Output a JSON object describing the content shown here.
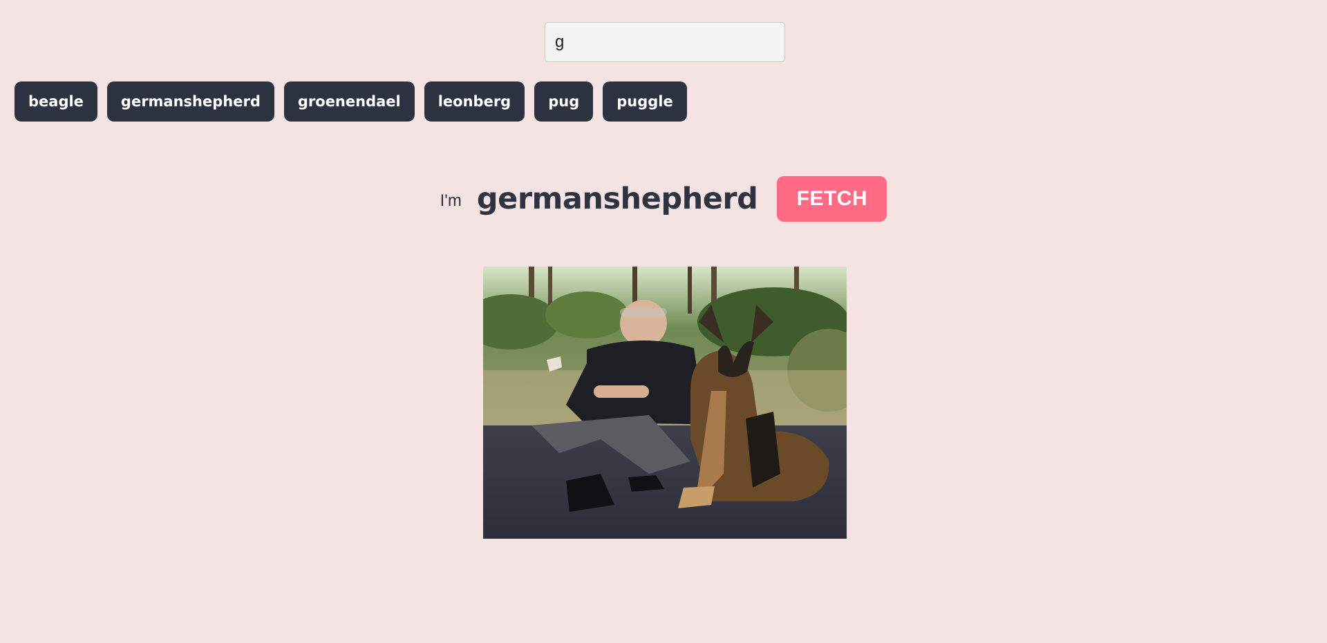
{
  "search": {
    "value": "g",
    "placeholder": ""
  },
  "breeds": [
    {
      "label": "beagle"
    },
    {
      "label": "germanshepherd"
    },
    {
      "label": "groenendael"
    },
    {
      "label": "leonberg"
    },
    {
      "label": "pug"
    },
    {
      "label": "puggle"
    }
  ],
  "headline": {
    "prefix": "I'm",
    "breed": "germanshepherd",
    "button_label": "FETCH"
  },
  "photo": {
    "alt": "germanshepherd"
  },
  "colors": {
    "background": "#f5e3e4",
    "chip": "#2d3240",
    "accent": "#ff6b84",
    "text": "#2d3340"
  }
}
